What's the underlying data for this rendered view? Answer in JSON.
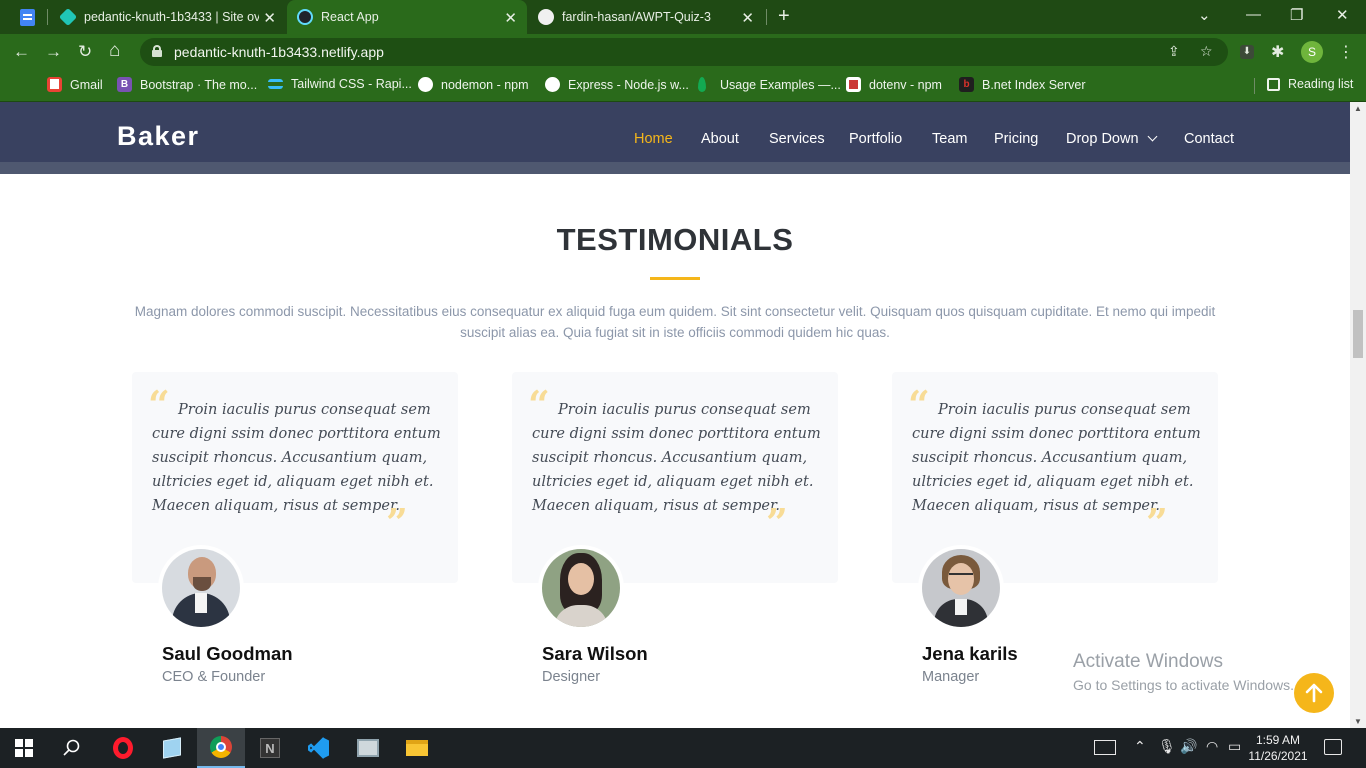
{
  "browser": {
    "tabs": [
      {
        "title": "pedantic-knuth-1b3433 | Site ove",
        "icon": "netlify-icon",
        "active": false
      },
      {
        "title": "React App",
        "icon": "react-icon",
        "active": true
      },
      {
        "title": "fardin-hasan/AWPT-Quiz-3",
        "icon": "github-icon",
        "active": false
      }
    ],
    "new_tab": "+",
    "url": "pedantic-knuth-1b3433.netlify.app",
    "profile_initial": "S",
    "bookmarks": [
      {
        "label": "Gmail",
        "icon": "gmail-icon",
        "color": "#ea4335"
      },
      {
        "label": "Bootstrap · The mo...",
        "icon": "bootstrap-icon",
        "color": "#7952b3"
      },
      {
        "label": "Tailwind CSS - Rapi...",
        "icon": "tailwind-icon",
        "color": "#38bdf8"
      },
      {
        "label": "nodemon - npm",
        "icon": "globe-icon",
        "color": "#ffffff"
      },
      {
        "label": "Express - Node.js w...",
        "icon": "globe-icon",
        "color": "#ffffff"
      },
      {
        "label": "Usage Examples —...",
        "icon": "mongodb-icon",
        "color": "#13aa52"
      },
      {
        "label": "dotenv - npm",
        "icon": "npm-icon",
        "color": "#cb3837"
      },
      {
        "label": "B.net Index Server",
        "icon": "bnet-icon",
        "color": "#d9322b"
      }
    ],
    "reading_list": "Reading list"
  },
  "site": {
    "logo": "Baker",
    "nav": [
      "Home",
      "About",
      "Services",
      "Portfolio",
      "Team",
      "Pricing",
      "Drop Down",
      "Contact"
    ],
    "active_nav": "Home",
    "accent_color": "#f5b61a",
    "header_color": "#394160"
  },
  "testimonials": {
    "title": "TESTIMONIALS",
    "lead": "Magnam dolores commodi suscipit. Necessitatibus eius consequatur ex aliquid fuga eum quidem. Sit sint consectetur velit. Quisquam quos quisquam cupiditate. Et nemo qui impedit suscipit alias ea. Quia fugiat sit in iste officiis commodi quidem hic quas.",
    "items": [
      {
        "quote": "Proin iaculis purus consequat sem cure digni ssim donec porttitora entum suscipit rhoncus. Accusantium quam, ultricies eget id, aliquam eget nibh et. Maecen aliquam, risus at semper.",
        "name": "Saul Goodman",
        "role": "CEO & Founder"
      },
      {
        "quote": "Proin iaculis purus consequat sem cure digni ssim donec porttitora entum suscipit rhoncus. Accusantium quam, ultricies eget id, aliquam eget nibh et. Maecen aliquam, risus at semper.",
        "name": "Sara Wilson",
        "role": "Designer"
      },
      {
        "quote": "Proin iaculis purus consequat sem cure digni ssim donec porttitora entum suscipit rhoncus. Accusantium quam, ultricies eget id, aliquam eget nibh et. Maecen aliquam, risus at semper.",
        "name": "Jena karils",
        "role": "Manager"
      }
    ]
  },
  "watermark": {
    "title": "Activate Windows",
    "subtitle": "Go to Settings to activate Windows."
  },
  "taskbar": {
    "time": "1:59 AM",
    "date": "11/26/2021"
  }
}
